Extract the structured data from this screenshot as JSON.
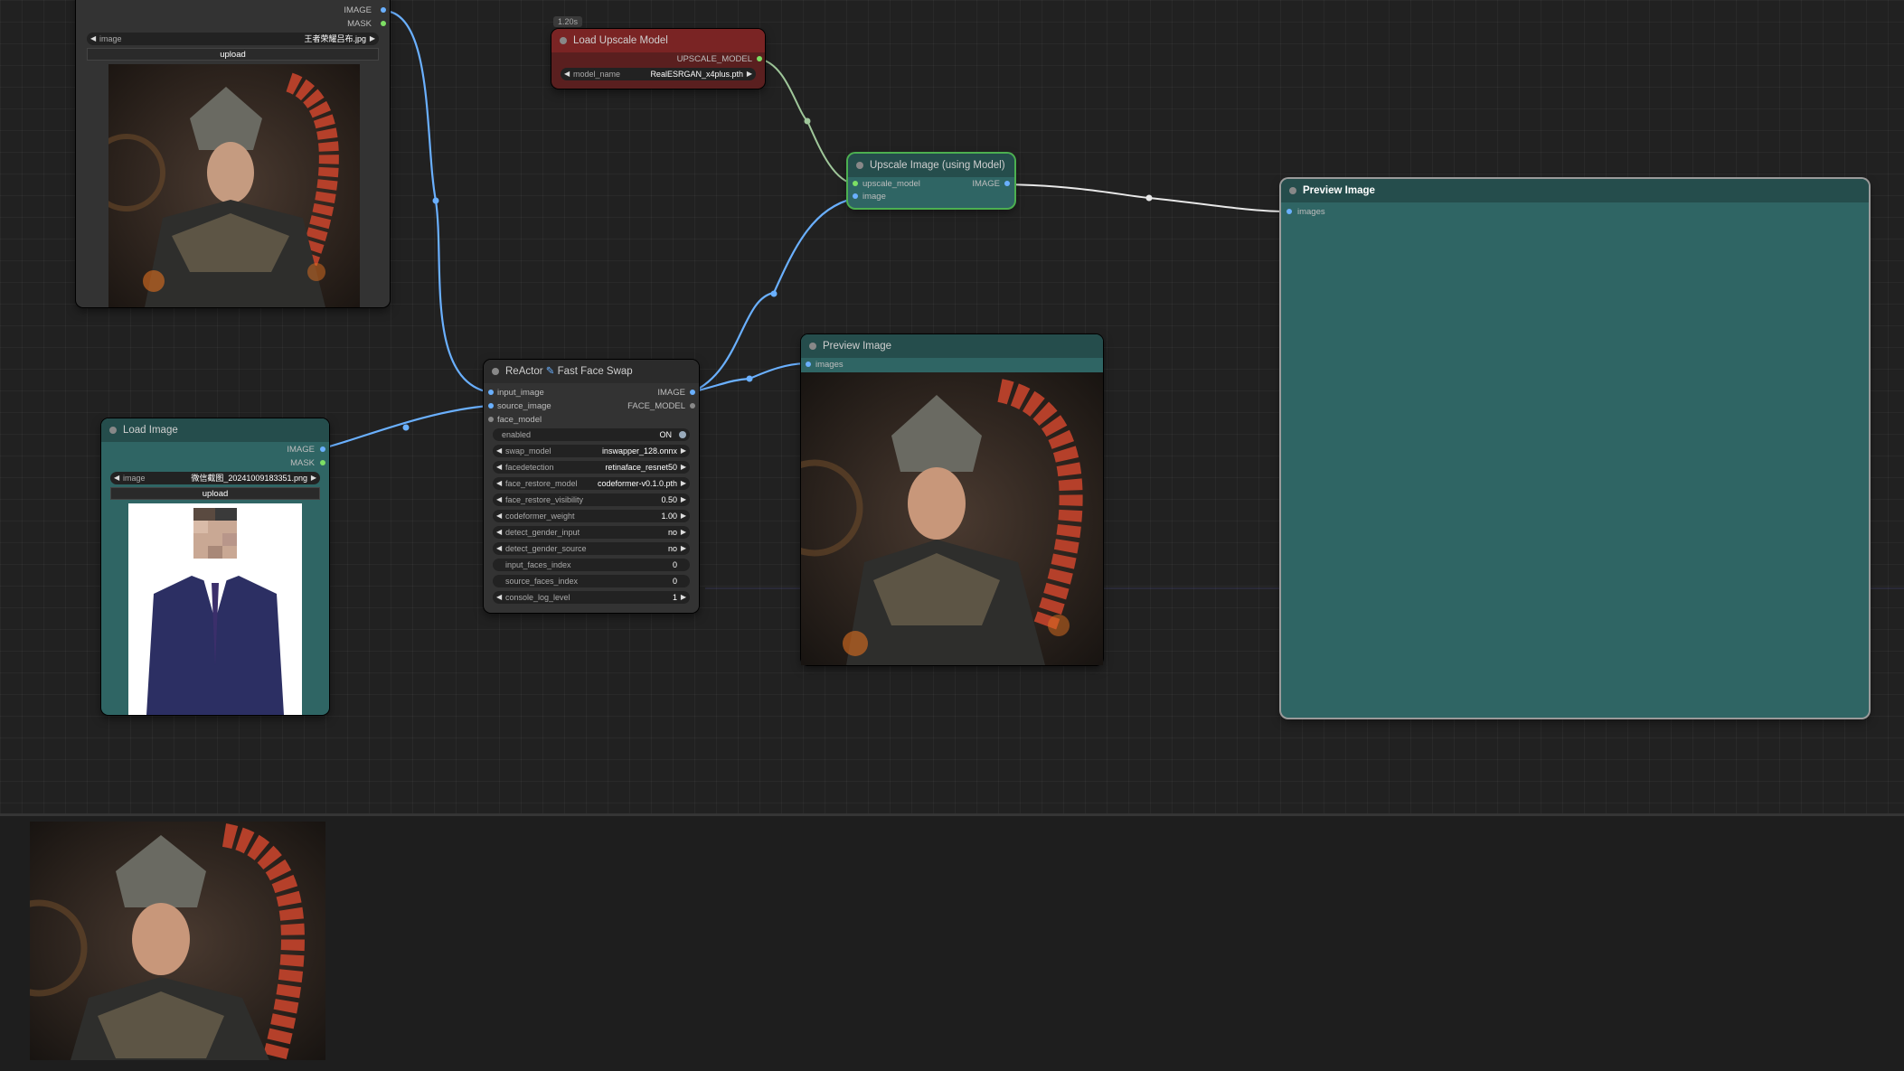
{
  "colors": {
    "canvas": "#212121",
    "node_green_body": "#2f6564",
    "node_green_title": "#254d4c",
    "node_red_title": "#7a2424",
    "node_gray_body": "#333333",
    "link_blue": "#6ab0ff",
    "link_white": "#e8e8e8",
    "link_green": "#9fc79a",
    "slot_blue": "#6ab0ff",
    "slot_green": "#7ddf64"
  },
  "load_image_top": {
    "outputs": [
      "IMAGE",
      "MASK"
    ],
    "image_widget": {
      "name": "image",
      "value": "王者荣耀吕布.jpg"
    },
    "upload_label": "upload",
    "preview_icon": "armored-warrior-image"
  },
  "load_upscale_model": {
    "timing_badge": "1.20s",
    "title": "Load Upscale Model",
    "output": "UPSCALE_MODEL",
    "model_widget": {
      "name": "model_name",
      "value": "RealESRGAN_x4plus.pth"
    }
  },
  "upscale_image": {
    "title": "Upscale Image (using Model)",
    "inputs": [
      "upscale_model",
      "image"
    ],
    "output": "IMAGE"
  },
  "preview_large": {
    "title": "Preview Image",
    "input": "images"
  },
  "load_image_bottom": {
    "title": "Load Image",
    "outputs": [
      "IMAGE",
      "MASK"
    ],
    "image_widget": {
      "name": "image",
      "value": "微信截图_20241009183351.png"
    },
    "upload_label": "upload",
    "preview_icon": "man-in-suit-photo"
  },
  "reactor": {
    "title_part1": "ReActor",
    "title_icon": "pen-icon",
    "title_part2": "Fast Face Swap",
    "inputs": [
      "input_image",
      "source_image",
      "face_model"
    ],
    "outputs": [
      "IMAGE",
      "FACE_MODEL"
    ],
    "toggle": {
      "name": "enabled",
      "value": "ON"
    },
    "widgets": [
      {
        "name": "swap_model",
        "value": "inswapper_128.onnx",
        "arrows": true
      },
      {
        "name": "facedetection",
        "value": "retinaface_resnet50",
        "arrows": true
      },
      {
        "name": "face_restore_model",
        "value": "codeformer-v0.1.0.pth",
        "arrows": true
      },
      {
        "name": "face_restore_visibility",
        "value": "0.50",
        "arrows": true
      },
      {
        "name": "codeformer_weight",
        "value": "1.00",
        "arrows": true
      },
      {
        "name": "detect_gender_input",
        "value": "no",
        "arrows": true
      },
      {
        "name": "detect_gender_source",
        "value": "no",
        "arrows": true
      },
      {
        "name": "input_faces_index",
        "value": "0",
        "arrows": false
      },
      {
        "name": "source_faces_index",
        "value": "0",
        "arrows": false
      },
      {
        "name": "console_log_level",
        "value": "1",
        "arrows": true
      }
    ]
  },
  "preview_mid": {
    "title": "Preview Image",
    "input": "images",
    "preview_icon": "face-swapped-warrior-image"
  },
  "bottom_panel": {
    "thumbnail_icon": "face-swapped-warrior-thumbnail"
  }
}
